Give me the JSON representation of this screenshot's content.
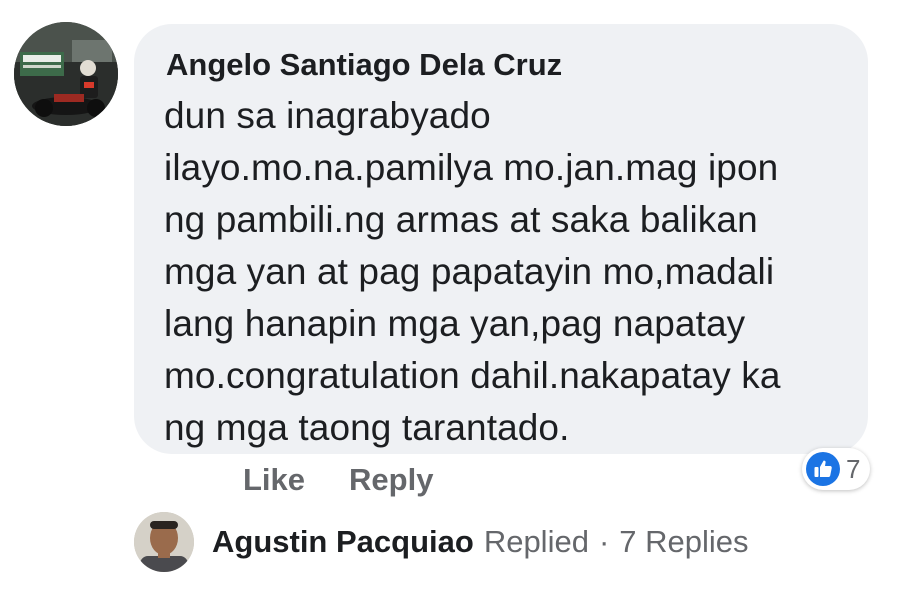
{
  "comment": {
    "author": "Angelo Santiago Dela Cruz",
    "text": "dun sa inagrabyado\nilayo.mo.na.pamilya mo.jan.mag ipon\nng pambili.ng armas at saka balikan\nmga yan at pag papatayin mo,madali\nlang hanapin mga yan,pag napatay\nmo.congratulation dahil.nakapatay ka\nng mga taong tarantado.",
    "avatar_icon": "user-avatar-photo"
  },
  "actions": {
    "like_label": "Like",
    "reply_label": "Reply"
  },
  "reactions": {
    "icon": "thumbs-up-icon",
    "count": "7",
    "color": "#1b74e4"
  },
  "reply_summary": {
    "name": "Agustin Pacquiao",
    "action": "Replied",
    "separator": "·",
    "count_label": "7 Replies",
    "avatar_icon": "user-avatar-photo"
  }
}
